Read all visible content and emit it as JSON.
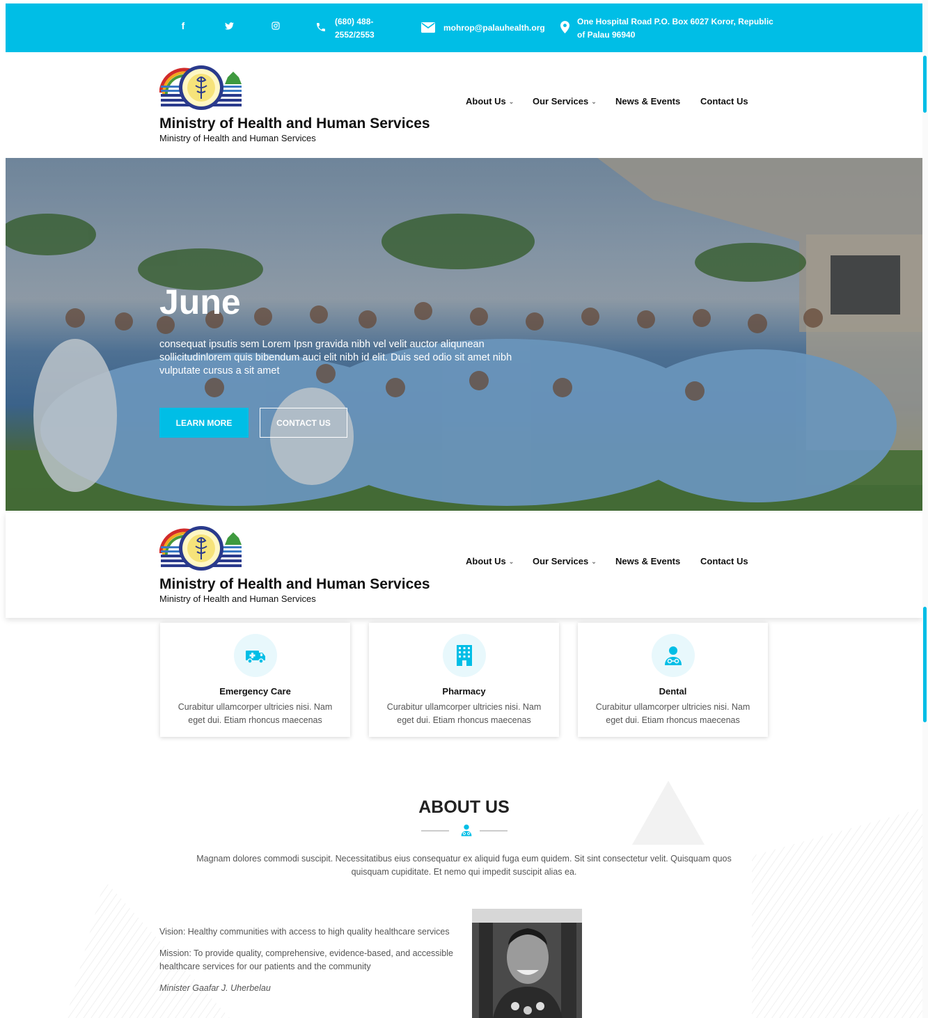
{
  "topbar": {
    "phone": "(680) 488-2552/2553",
    "email": "mohrop@palauhealth.org",
    "address": "One Hospital Road P.O. Box 6027 Koror, Republic of Palau 96940",
    "social": [
      "facebook-icon",
      "twitter-icon",
      "instagram-icon"
    ]
  },
  "header": {
    "brand_title": "Ministry of Health and Human Services",
    "brand_subtitle": "Ministry of Health and Human Services",
    "nav": [
      "About Us",
      "Our Services",
      "News & Events",
      "Contact Us"
    ]
  },
  "hero": {
    "heading": "June",
    "text": "consequat ipsutis sem Lorem Ipsn gravida nibh vel velit auctor aliqunean sollicitudinlorem quis bibendum auci elit nibh id elit. Duis sed odio sit amet nibh vulputate cursus a sit amet",
    "learn_more": "LEARN MORE",
    "contact_us": "CONTACT US"
  },
  "services": [
    {
      "title": "Emergency Care",
      "text": "Curabitur ullamcorper ultricies nisi. Nam eget dui. Etiam rhoncus maecenas",
      "icon": "ambulance-icon"
    },
    {
      "title": "Pharmacy",
      "text": "Curabitur ullamcorper ultricies nisi. Nam eget dui. Etiam rhoncus maecenas",
      "icon": "building-icon"
    },
    {
      "title": "Dental",
      "text": "Curabitur ullamcorper ultricies nisi. Nam eget dui. Etiam rhoncus maecenas",
      "icon": "doctor-icon"
    }
  ],
  "about": {
    "title": "ABOUT US",
    "text": "Magnam dolores commodi suscipit. Necessitatibus eius consequatur ex aliquid fuga eum quidem. Sit sint consectetur velit. Quisquam quos quisquam cupiditate. Et nemo qui impedit suscipit alias ea.",
    "vision": "Vision: Healthy communities with access to high quality healthcare services",
    "mission": "Mission: To provide quality, comprehensive, evidence-based, and accessible healthcare services for our patients and the community",
    "minister": "Minister Gaafar J. Uherbelau"
  },
  "colors": {
    "accent": "#00bee6",
    "text_dark": "#111111",
    "text_muted": "#555555"
  }
}
